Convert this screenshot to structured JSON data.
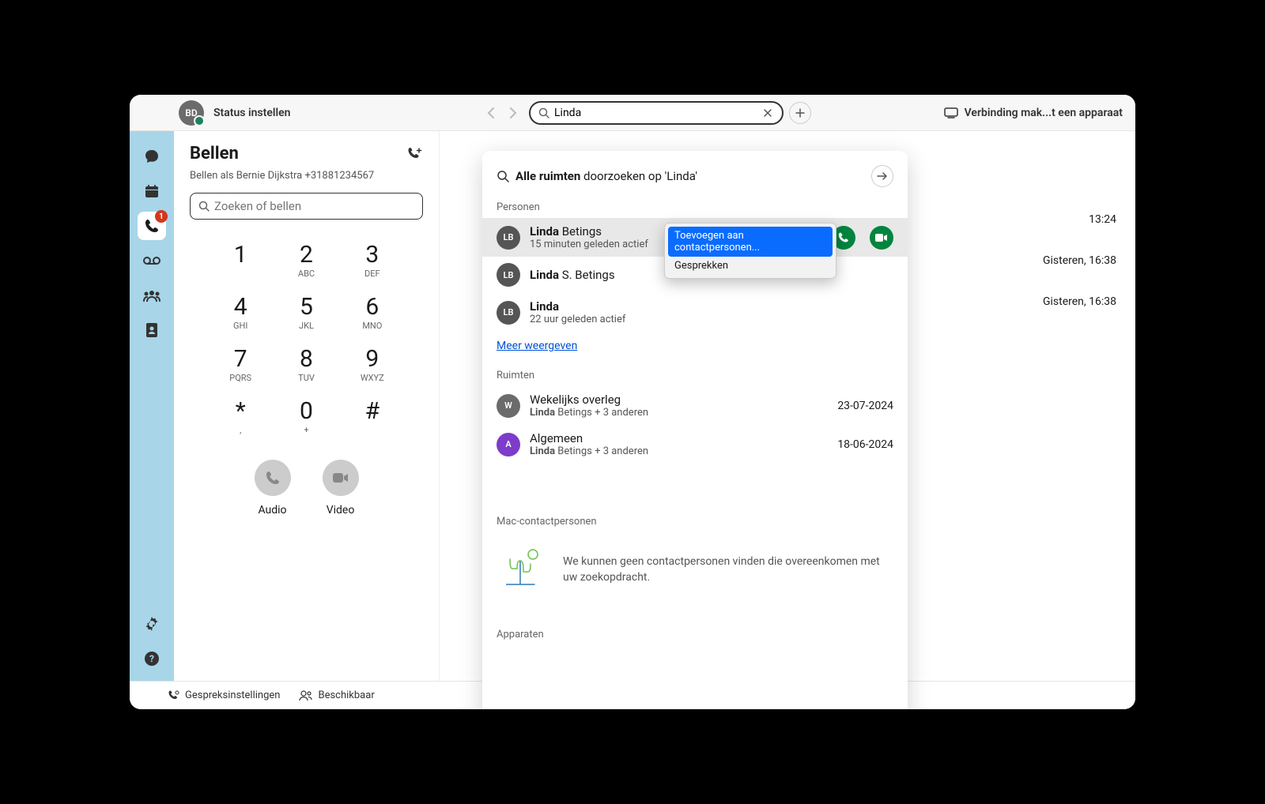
{
  "header": {
    "avatar_initials": "BD",
    "status": "Status instellen",
    "search_value": "Linda",
    "connect_device": "Verbinding mak...t een apparaat"
  },
  "leftrail": {
    "call_badge": "1"
  },
  "call_panel": {
    "title": "Bellen",
    "subtitle": "Bellen als Bernie Dijkstra +31881234567",
    "search_placeholder": "Zoeken of bellen",
    "keys": [
      {
        "digit": "1",
        "letters": ""
      },
      {
        "digit": "2",
        "letters": "ABC"
      },
      {
        "digit": "3",
        "letters": "DEF"
      },
      {
        "digit": "4",
        "letters": "GHI"
      },
      {
        "digit": "5",
        "letters": "JKL"
      },
      {
        "digit": "6",
        "letters": "MNO"
      },
      {
        "digit": "7",
        "letters": "PQRS"
      },
      {
        "digit": "8",
        "letters": "TUV"
      },
      {
        "digit": "9",
        "letters": "WXYZ"
      },
      {
        "digit": "*",
        "letters": ","
      },
      {
        "digit": "0",
        "letters": "+"
      },
      {
        "digit": "#",
        "letters": ""
      }
    ],
    "audio_label": "Audio",
    "video_label": "Video"
  },
  "right_times": [
    "13:24",
    "Gisteren, 16:38",
    "Gisteren, 16:38"
  ],
  "bottom": {
    "call_settings": "Gespreksinstellingen",
    "availability": "Beschikbaar"
  },
  "dropdown": {
    "all_rooms_bold": "Alle ruimten",
    "all_rooms_rest": " doorzoeken op 'Linda'",
    "people_label": "Personen",
    "people": [
      {
        "initials": "LB",
        "bold": "Linda",
        "rest": " Betings",
        "sub": "15 minuten geleden actief",
        "highlight": true,
        "actions": true
      },
      {
        "initials": "LB",
        "bold": "Linda",
        "rest": " S. Betings",
        "sub": "",
        "highlight": false,
        "actions": false
      },
      {
        "initials": "LB",
        "bold": "Linda",
        "rest": "",
        "sub": "22 uur geleden actief",
        "highlight": false,
        "actions": false
      }
    ],
    "more_link": "Meer weergeven",
    "rooms_label": "Ruimten",
    "rooms": [
      {
        "initials": "W",
        "avatar_class": "w",
        "title": "Wekelijks overleg",
        "sub_bold": "Linda",
        "sub_rest": " Betings + 3 anderen",
        "date": "23-07-2024"
      },
      {
        "initials": "A",
        "avatar_class": "a",
        "title": "Algemeen",
        "sub_bold": "Linda",
        "sub_rest": " Betings + 3 anderen",
        "date": "18-06-2024"
      }
    ],
    "mac_contacts_label": "Mac-contactpersonen",
    "empty_text": "We kunnen geen contactpersonen vinden die overeenkomen met uw zoekopdracht.",
    "devices_label": "Apparaten"
  },
  "context_menu": {
    "add": "Toevoegen aan contactpersonen...",
    "calls": "Gesprekken"
  }
}
